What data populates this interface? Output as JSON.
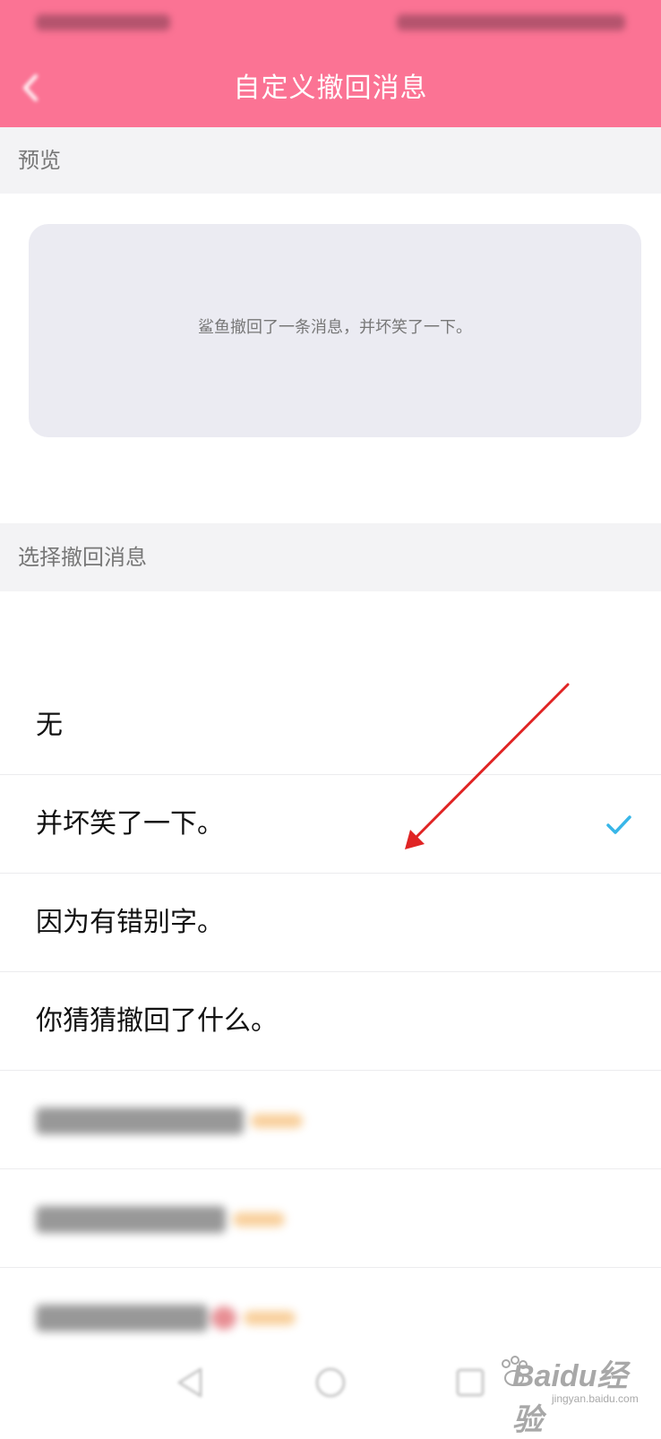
{
  "header": {
    "title": "自定义撤回消息",
    "back_icon": "chevron-left-icon",
    "color": "#fb7394"
  },
  "preview": {
    "section_label": "预览",
    "message": "鲨鱼撤回了一条消息，并坏笑了一下。"
  },
  "select": {
    "section_label": "选择撤回消息",
    "options": [
      {
        "label": "无",
        "selected": false
      },
      {
        "label": "并坏笑了一下。",
        "selected": true
      },
      {
        "label": "因为有错别字。",
        "selected": false
      },
      {
        "label": "你猜猜撤回了什么。",
        "selected": false
      }
    ],
    "check_color": "#38b6e8"
  },
  "annotation": {
    "arrow_color": "#e02424"
  },
  "watermark": {
    "brand": "Baidu经验",
    "url": "jingyan.baidu.com"
  }
}
